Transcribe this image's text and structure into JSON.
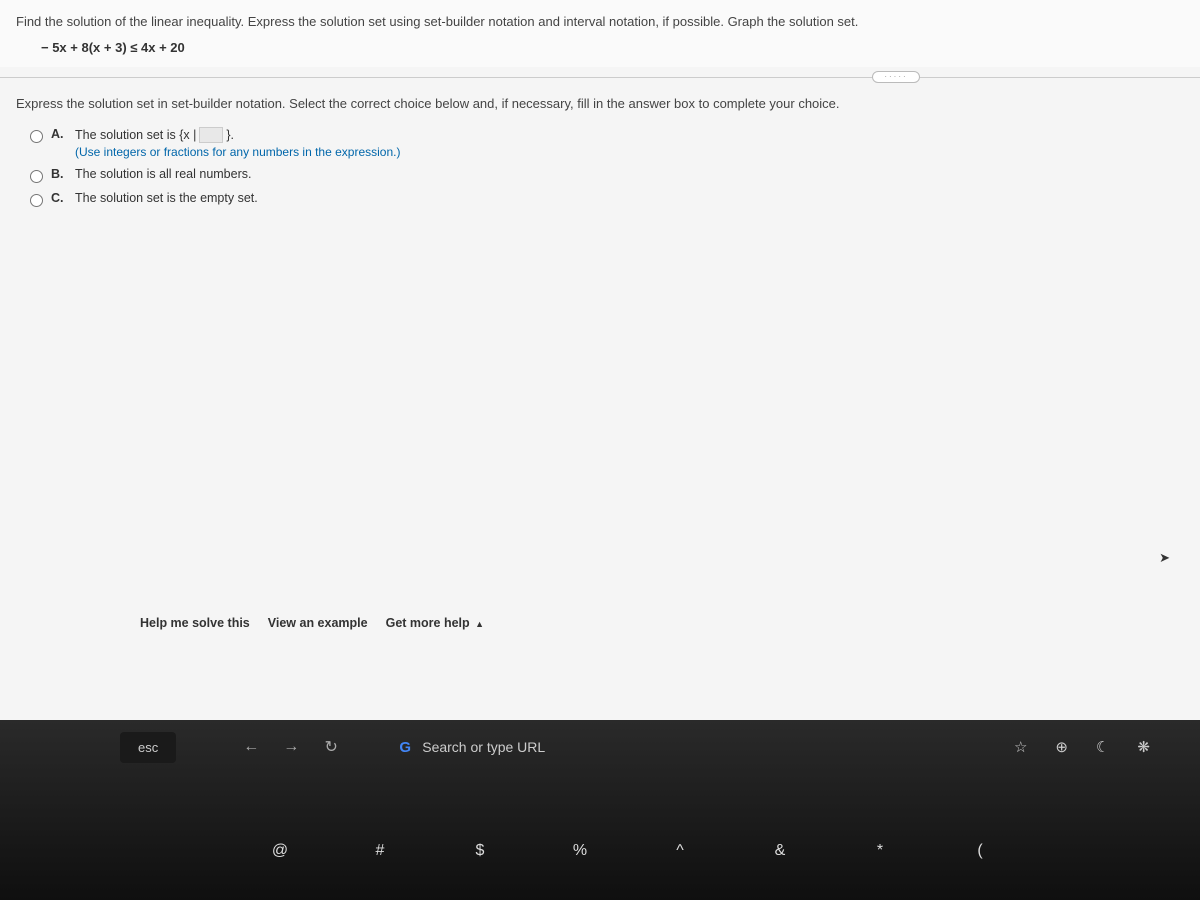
{
  "problem": {
    "statement": "Find the solution of the linear inequality. Express the solution set using set-builder notation and interval notation, if possible. Graph the solution set.",
    "inequality": "− 5x + 8(x + 3) ≤ 4x + 20"
  },
  "divider_dots": "·····",
  "instruction": "Express the solution set in set-builder notation. Select the correct choice below and, if necessary, fill in the answer box to complete your choice.",
  "choices": {
    "a": {
      "letter": "A.",
      "text_pre": "The solution set is {x | ",
      "text_post": " }.",
      "note": "(Use integers or fractions for any numbers in the expression.)"
    },
    "b": {
      "letter": "B.",
      "text": "The solution is all real numbers."
    },
    "c": {
      "letter": "C.",
      "text": "The solution set is the empty set."
    }
  },
  "help": {
    "solve": "Help me solve this",
    "example": "View an example",
    "more": "Get more help",
    "caret": "▲"
  },
  "browser": {
    "esc": "esc",
    "back": "←",
    "forward": "→",
    "reload": "↻",
    "g": "G",
    "search_placeholder": "Search or type URL",
    "star": "☆",
    "plus": "⊕",
    "moon": "☾",
    "sparkle": "❋"
  },
  "keyboard": {
    "k1": "!",
    "k2": "@",
    "k3": "#",
    "k4": "$",
    "k5": "%",
    "k6": "^",
    "k7": "&",
    "k8": "*",
    "k9": "("
  }
}
